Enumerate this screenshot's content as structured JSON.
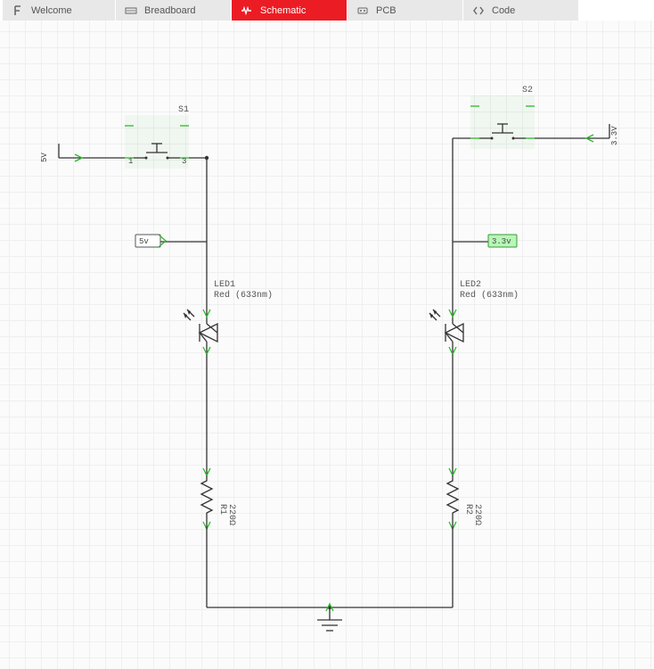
{
  "tabs": [
    {
      "label": "Welcome",
      "icon": "fritzing-icon"
    },
    {
      "label": "Breadboard",
      "icon": "breadboard-icon"
    },
    {
      "label": "Schematic",
      "icon": "schematic-icon",
      "active": true
    },
    {
      "label": "PCB",
      "icon": "pcb-icon"
    },
    {
      "label": "Code",
      "icon": "code-icon"
    }
  ],
  "schematic": {
    "components": {
      "s1": {
        "name": "S1"
      },
      "s2": {
        "name": "S2"
      },
      "led1": {
        "name": "LED1",
        "subtitle": "Red (633nm)"
      },
      "led2": {
        "name": "LED2",
        "subtitle": "Red (633nm)"
      },
      "r1": {
        "name": "R1",
        "value": "220Ω"
      },
      "r2": {
        "name": "R2",
        "value": "220Ω"
      }
    },
    "netlabels": {
      "nl5v": "5v",
      "nl33v": "3.3v"
    },
    "power_pins": {
      "p5v": "5V",
      "p33v": "3.3V"
    }
  },
  "chart_data": {
    "type": "diagram",
    "description": "Electronic schematic with two parallel branches sharing a common ground",
    "branches": [
      {
        "power_source": "5V",
        "components": [
          {
            "ref": "S1",
            "type": "pushbutton-switch"
          },
          {
            "ref": "LED1",
            "type": "LED",
            "color": "Red",
            "wavelength_nm": 633
          },
          {
            "ref": "R1",
            "type": "resistor",
            "value_ohms": 220
          }
        ],
        "net_label": "5v"
      },
      {
        "power_source": "3.3V",
        "components": [
          {
            "ref": "S2",
            "type": "pushbutton-switch"
          },
          {
            "ref": "LED2",
            "type": "LED",
            "color": "Red",
            "wavelength_nm": 633
          },
          {
            "ref": "R2",
            "type": "resistor",
            "value_ohms": 220
          }
        ],
        "net_label": "3.3v"
      }
    ],
    "common": {
      "ground": true
    }
  }
}
